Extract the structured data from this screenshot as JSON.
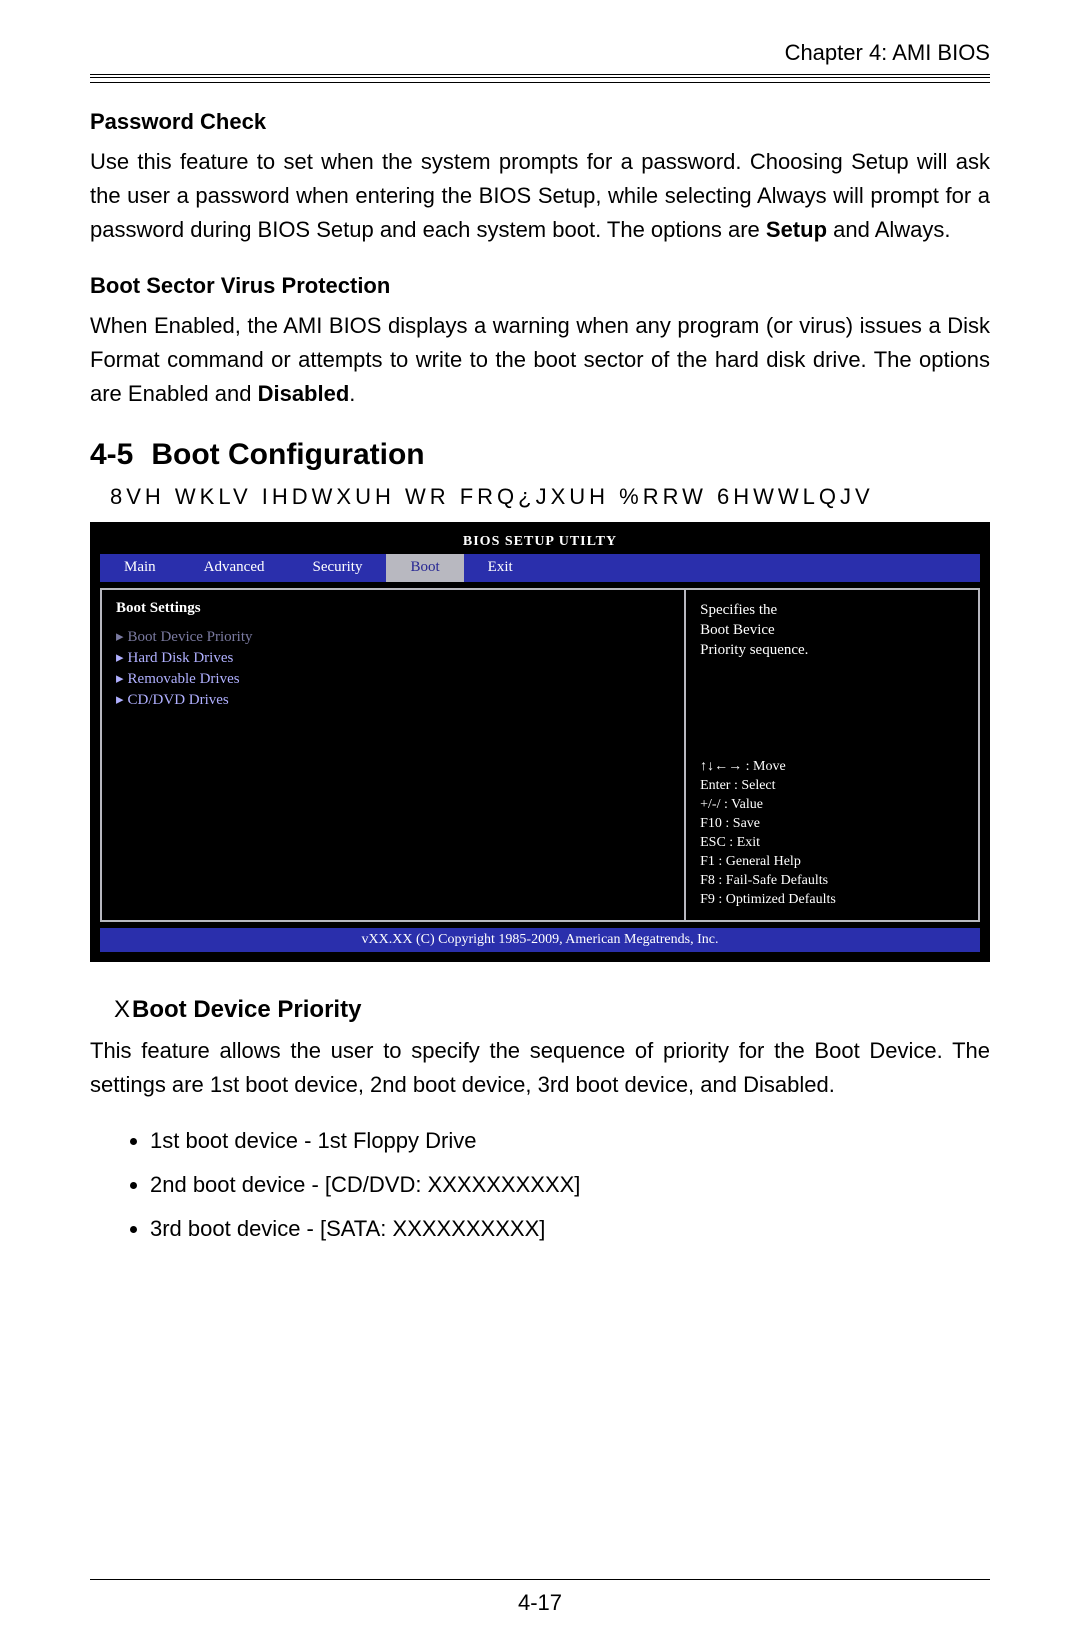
{
  "header": {
    "chapter": "Chapter 4: AMI BIOS"
  },
  "password_check": {
    "title": "Password Check",
    "p_pre": "Use this feature to set when the system prompts for a password.  Choosing Setup will ask the user a password when entering the BIOS Setup, while selecting Always will prompt for a password during BIOS Setup and each system boot.  The options are ",
    "bold": "Setup",
    "p_post": " and Always."
  },
  "boot_sector": {
    "title": "Boot Sector Virus Protection",
    "p_pre": "When Enabled, the AMI BIOS displays a warning when any program (or virus) issues a Disk Format command or attempts to write to the boot sector of the hard disk drive. The options are Enabled and ",
    "bold": "Disabled",
    "p_post": "."
  },
  "section": {
    "num": "4-5",
    "title": "Boot Configuration",
    "garbled": "8VH WKLV IHDWXUH WR FRQ¿JXUH %RRW 6HWWLQJV"
  },
  "bios": {
    "title": "BIOS SETUP UTILTY",
    "tabs": [
      "Main",
      "Advanced",
      "Security",
      "Boot",
      "Exit"
    ],
    "active_tab": "Boot",
    "left_header": "Boot Settings",
    "menu": [
      {
        "label": "Boot Device Priority",
        "selected": true
      },
      {
        "label": "Hard Disk Drives",
        "selected": false
      },
      {
        "label": "Removable Drives",
        "selected": false
      },
      {
        "label": "CD/DVD Drives",
        "selected": false
      }
    ],
    "desc": "Specifies the\nBoot Bevice\nPriority sequence.",
    "keys": "↑↓←→ : Move\nEnter : Select\n+/-/ : Value\nF10 : Save\nESC : Exit\nF1 : General Help\nF8 : Fail-Safe Defaults\nF9 : Optimized Defaults",
    "footer": "vXX.XX (C) Copyright 1985-2009, American Megatrends, Inc."
  },
  "boot_priority": {
    "marker": "X",
    "title": "Boot Device Priority",
    "desc": "This feature allows the user to specify the sequence of priority for the Boot Device. The settings are 1st boot device, 2nd boot device, 3rd boot device, and Disabled.",
    "items": [
      "1st boot device - 1st Floppy Drive",
      "2nd boot device - [CD/DVD: XXXXXXXXXX]",
      "3rd boot device - [SATA: XXXXXXXXXX]"
    ]
  },
  "page_number": "4-17"
}
